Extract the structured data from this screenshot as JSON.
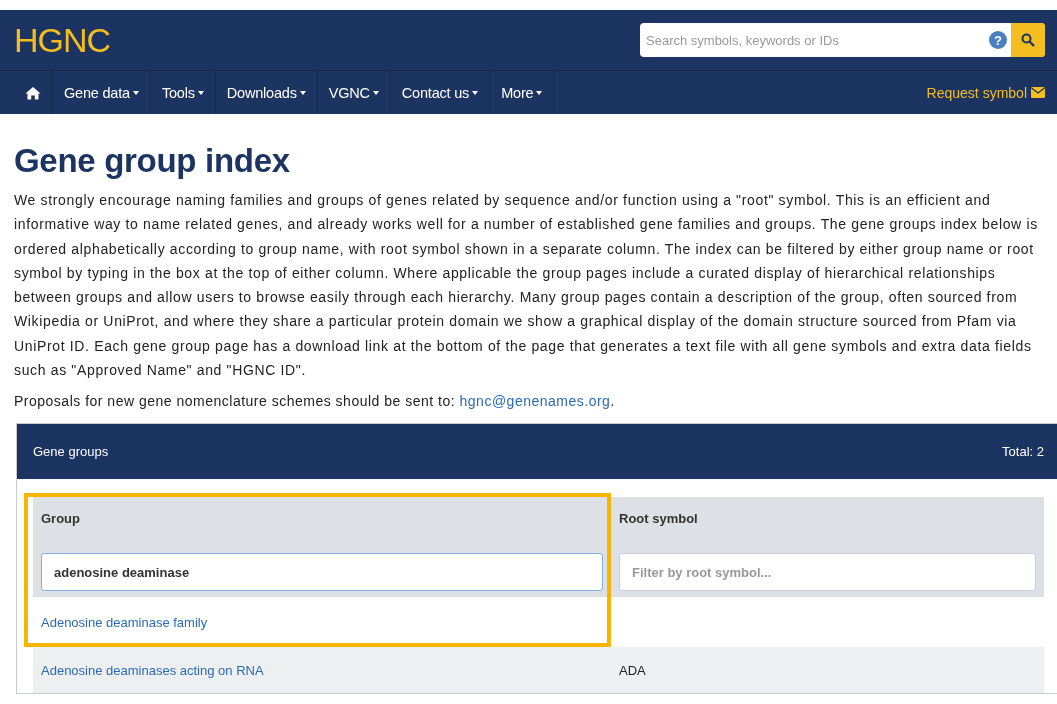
{
  "header": {
    "logo": "HGNC",
    "search": {
      "placeholder": "Search symbols, keywords or IDs"
    },
    "help": "?"
  },
  "nav": {
    "items": [
      {
        "kind": "home",
        "dropdown": false
      },
      {
        "kind": "menu",
        "label": "Gene data",
        "dropdown": true
      },
      {
        "kind": "menu",
        "label": "Tools",
        "dropdown": true
      },
      {
        "kind": "menu",
        "label": "Downloads",
        "dropdown": true
      },
      {
        "kind": "menu",
        "label": "VGNC",
        "dropdown": true
      },
      {
        "kind": "menu",
        "label": "Contact us",
        "dropdown": true
      },
      {
        "kind": "menu",
        "label": "More",
        "dropdown": true
      }
    ],
    "request": "Request symbol"
  },
  "page": {
    "title": "Gene group index",
    "intro_lines": [
      "We strongly encourage naming families and groups of genes related by sequence and/or function using a \"root\" symbol. This is an efficient and",
      "informative way to name related genes, and already works well for a number of established gene families and groups. The gene groups index below is",
      "ordered alphabetically according to group name, with root symbol shown in a separate column. The index can be filtered by either group name or root",
      "symbol by typing in the box at the top of either column. Where applicable the group pages include a curated display of hierarchical relationships",
      "between groups and allow users to browse easily through each hierarchy. Many group pages contain a description of the group, often sourced from",
      "Wikipedia or UniProt, and where they share a particular protein domain we show a graphical display of the domain structure sourced from Pfam via",
      "UniProt ID. Each gene group page has a download link at the bottom of the page that generates a text file with all gene symbols and extra data fields",
      "such as \"Approved Name\" and \"HGNC ID\"."
    ],
    "proposal": {
      "text": "Proposals for new gene nomenclature schemes should be sent to: ",
      "link": "hgnc@genenames.org",
      "suffix": "."
    }
  },
  "panel": {
    "title": "Gene groups",
    "total": "Total: 2",
    "highlight_box": true,
    "columns": [
      {
        "label": "Group",
        "filter": {
          "value": "adenosine deaminase"
        }
      },
      {
        "label": "Root symbol",
        "filter": {
          "placeholder": "Filter by root symbol..."
        }
      }
    ],
    "rows": [
      {
        "group": "Adenosine deaminase family"
      },
      {
        "group": "Adenosine deaminases acting on RNA",
        "root_symbol": "ADA"
      }
    ]
  }
}
